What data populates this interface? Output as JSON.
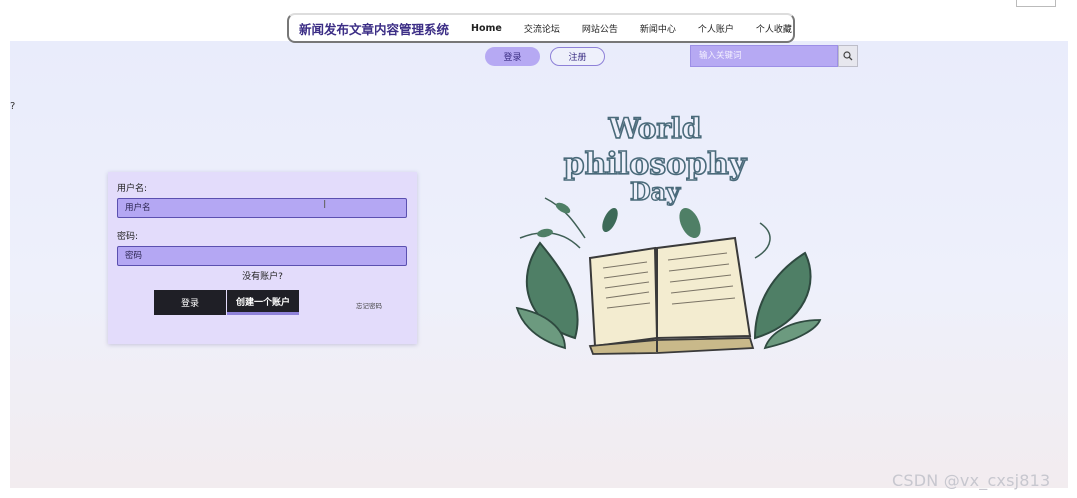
{
  "header": {
    "site_title": "新闻发布文章内容管理系统",
    "nav": [
      "Home",
      "交流论坛",
      "网站公告",
      "新闻中心",
      "个人账户",
      "个人收藏"
    ]
  },
  "auth": {
    "login_label": "登录",
    "register_label": "注册"
  },
  "search": {
    "placeholder": "输入关键词",
    "icon": "search-icon"
  },
  "left_glyph": "?",
  "login_form": {
    "username_label": "用户名:",
    "username_placeholder": "用户名",
    "password_label": "密码:",
    "password_placeholder": "密码",
    "no_account": "没有账户?",
    "login_button": "登录",
    "create_button": "创建一个账户",
    "forgot": "忘记密码"
  },
  "illustration": {
    "line1": "World",
    "line2": "philosophy",
    "line3": "Day"
  },
  "watermark": "CSDN @vx_cxsj813",
  "colors": {
    "accent": "#b6a9f3",
    "title": "#3c2e86",
    "button_dark": "#1f1f26"
  }
}
